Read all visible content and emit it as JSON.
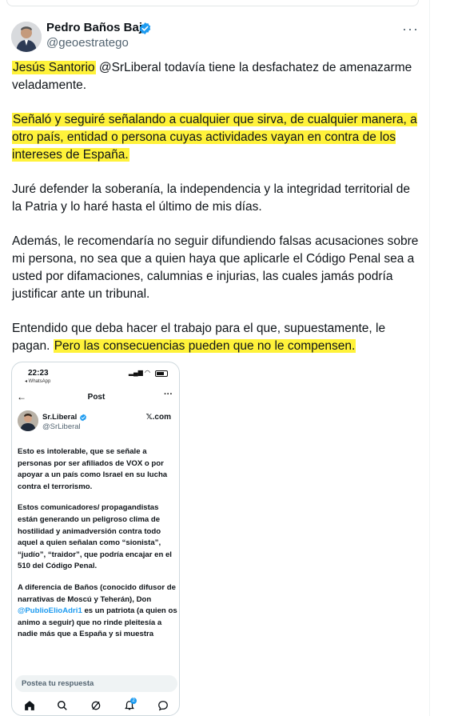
{
  "author": {
    "name": "Pedro Baños Bajo",
    "handle": "@geoestratego"
  },
  "tweet": {
    "p1_hl": "Jesús Santorio",
    "p1_mention": "@SrLiberal",
    "p1_rest": " todavía tiene la desfachatez de amenazarme veladamente.",
    "p2_hl": "Señaló y seguiré señalando a cualquier que sirva, de cualquier manera, a otro país, entidad o persona cuyas actividades vayan en contra de los intereses de España.",
    "p3": "Juré defender la soberanía, la independencia y la integridad territorial de la Patria y lo haré hasta el último de mis días.",
    "p4": "Además, le recomendaría no seguir difundiendo falsas acusaciones sobre mi persona, no sea que a quien haya que aplicarle el Código Penal sea a usted por difamaciones, calumnias e injurias, las cuales jamás podría justificar ante un tribunal.",
    "p5_plain": "Entendido que deba hacer el trabajo para el que, supuestamente, le pagan. ",
    "p5_hl": "Pero las consecuencias pueden que no le compensen."
  },
  "screenshot": {
    "status_time": "22:23",
    "status_app": "◂ WhatsApp",
    "nav_title": "Post",
    "inner_author": {
      "name": "Sr.Liberal",
      "handle": "@SrLiberal",
      "source": "𝕏.com"
    },
    "para1": "Esto es intolerable, que se señale a personas por ser afiliados de VOX o por apoyar a un país como Israel en su lucha contra el terrorismo.",
    "para2": "Estos comunicadores/ propagandistas están generando un peligroso clima de hostilidad y animadversión contra todo aquel a quien señalan como “sionista”, “judío”, “traidor”, que podría encajar en el 510 del Código Penal.",
    "para3_a": "A diferencia de Baños (conocido difusor de narrativas de Moscú y Teherán), Don ",
    "para3_link": "@PublioElioAdri1",
    "para3_b": " es un patriota (a quien os animo a seguir) que no rinde pleitesía a nadie más que a España y si muestra",
    "reply_placeholder": "Postea tu respuesta",
    "badge_count": "2"
  },
  "colors": {
    "highlight": "#fff23a",
    "verified": "#1d9bf0",
    "muted": "#536471"
  }
}
